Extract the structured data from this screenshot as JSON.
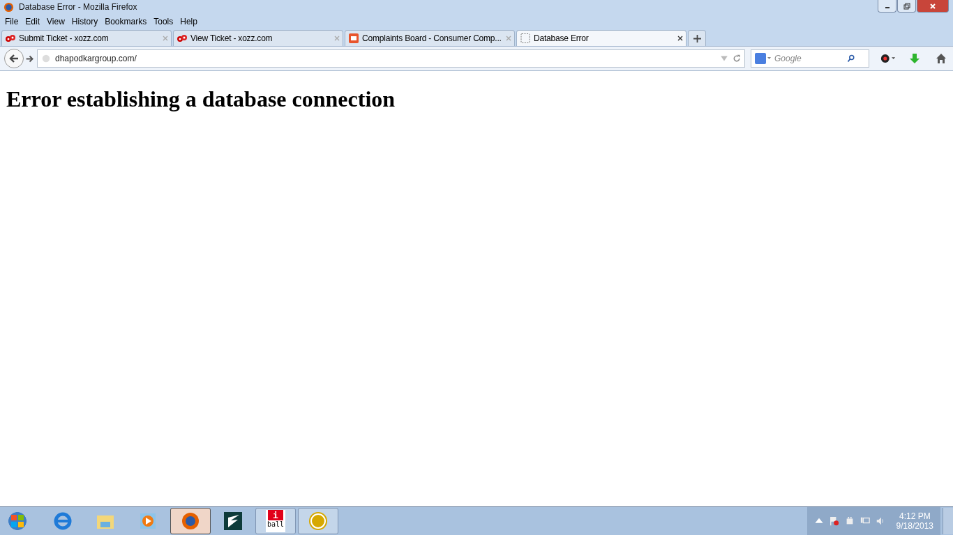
{
  "window": {
    "title": "Database Error - Mozilla Firefox"
  },
  "menu": [
    "File",
    "Edit",
    "View",
    "History",
    "Bookmarks",
    "Tools",
    "Help"
  ],
  "tabs": [
    {
      "label": "Submit Ticket - xozz.com",
      "kind": "xozz",
      "selected": false
    },
    {
      "label": "View Ticket - xozz.com",
      "kind": "xozz",
      "selected": false
    },
    {
      "label": "Complaints Board - Consumer Comp...",
      "kind": "cb",
      "selected": false
    },
    {
      "label": "Database Error",
      "kind": "blank",
      "selected": true
    }
  ],
  "address": {
    "value": "dhapodkargroup.com/"
  },
  "search": {
    "placeholder": "Google"
  },
  "page": {
    "heading": "Error establishing a database connection"
  },
  "taskbar": {
    "items": [
      {
        "kind": "ie",
        "running": false,
        "selected": false
      },
      {
        "kind": "explorer",
        "running": false,
        "selected": false
      },
      {
        "kind": "media",
        "running": false,
        "selected": false
      },
      {
        "kind": "firefox",
        "running": true,
        "selected": true
      },
      {
        "kind": "wing",
        "running": false,
        "selected": false
      },
      {
        "kind": "iball",
        "running": true,
        "selected": false,
        "logo_top": "i",
        "logo_bottom": "ball"
      },
      {
        "kind": "fw",
        "running": true,
        "selected": false
      }
    ],
    "time": "4:12 PM",
    "date": "9/18/2013"
  }
}
